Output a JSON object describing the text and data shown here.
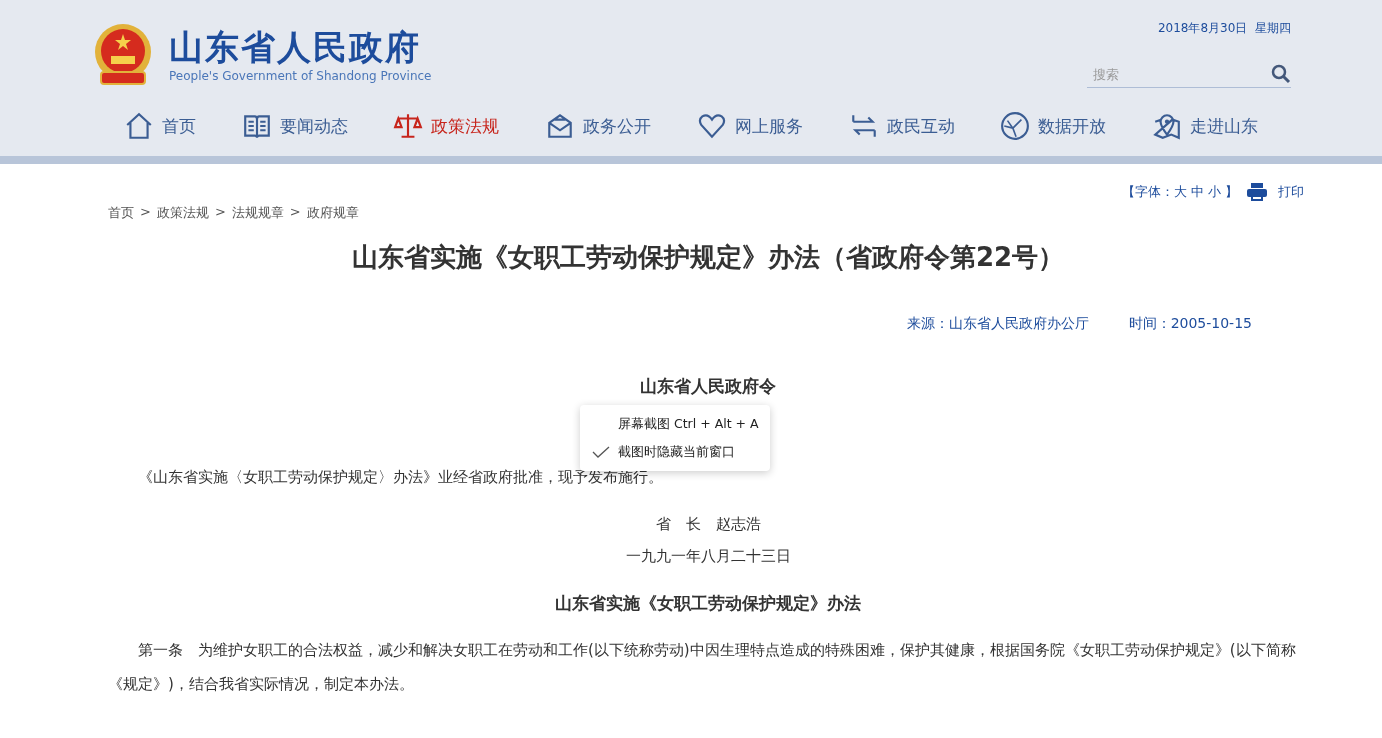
{
  "header": {
    "site_name": "山东省人民政府",
    "site_name_en": "People's Government of Shandong Province",
    "date": "2018年8月30日  星期四",
    "search": {
      "placeholder": "搜索"
    }
  },
  "nav": [
    {
      "label": "首页",
      "selected": false
    },
    {
      "label": "要闻动态",
      "selected": false
    },
    {
      "label": "政策法规",
      "selected": true
    },
    {
      "label": "政务公开",
      "selected": false
    },
    {
      "label": "网上服务",
      "selected": false
    },
    {
      "label": "政民互动",
      "selected": false
    },
    {
      "label": "数据开放",
      "selected": false
    },
    {
      "label": "走进山东",
      "selected": false
    }
  ],
  "tools": {
    "font_size": "【字体：大 中 小 】",
    "print": "打印"
  },
  "breadcrumb": [
    "首页",
    "政策法规",
    "法规规章",
    "政府规章"
  ],
  "breadcrumb_separator": ">",
  "article": {
    "title": "山东省实施《女职工劳动保护规定》办法（省政府令第22号）",
    "source": "来源：山东省人民政府办公厅",
    "time": "时间：2005-10-15",
    "blocks": [
      {
        "kind": "heading",
        "text": "山东省人民政府令"
      },
      {
        "kind": "paragraph",
        "text": "《山东省实施〈女职工劳动保护规定〉办法》业经省政府批准，现予发布施行。"
      },
      {
        "kind": "center",
        "text": "省　长　赵志浩"
      },
      {
        "kind": "center",
        "text": "一九九一年八月二十三日"
      },
      {
        "kind": "heading",
        "text": "山东省实施《女职工劳动保护规定》办法"
      },
      {
        "kind": "paragraph",
        "text": "第一条　为维护女职工的合法权益，减少和解决女职工在劳动和工作(以下统称劳动)中因生理特点造成的特殊困难，保护其健康，根据国务院《女职工劳动保护规定》(以下简称《规定》)，结合我省实际情况，制定本办法。"
      }
    ]
  },
  "context_menu": [
    {
      "label": "屏幕截图 Ctrl + Alt + A",
      "checked": false
    },
    {
      "label": "截图时隐藏当前窗口",
      "checked": true
    }
  ]
}
